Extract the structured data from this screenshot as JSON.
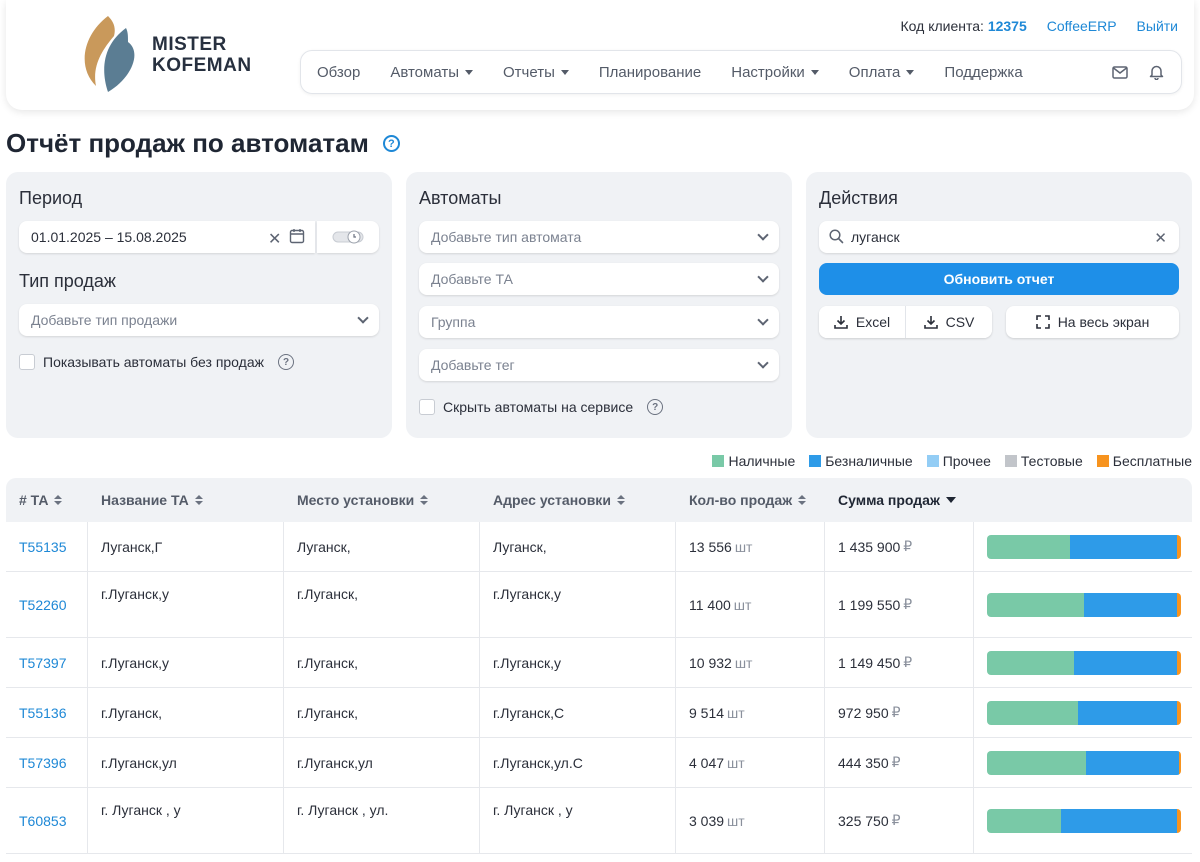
{
  "header": {
    "logo_line1": "MISTER",
    "logo_line2": "KOFEMAN",
    "client_label": "Код клиента:",
    "client_code": "12375",
    "erp_link": "CoffeeERP",
    "logout": "Выйти",
    "nav": [
      {
        "label": "Обзор",
        "dropdown": false
      },
      {
        "label": "Автоматы",
        "dropdown": true
      },
      {
        "label": "Отчеты",
        "dropdown": true
      },
      {
        "label": "Планирование",
        "dropdown": false
      },
      {
        "label": "Настройки",
        "dropdown": true
      },
      {
        "label": "Оплата",
        "dropdown": true
      },
      {
        "label": "Поддержка",
        "dropdown": false
      }
    ],
    "icons": [
      "mail-icon",
      "bell-icon"
    ]
  },
  "page": {
    "title": "Отчёт продаж по автоматам",
    "help": "?"
  },
  "period_panel": {
    "title": "Период",
    "date_range": "01.01.2025 – 15.08.2025",
    "sales_type_title": "Тип продаж",
    "sales_type_placeholder": "Добавьте тип продажи",
    "show_no_sales_label": "Показывать автоматы без продаж"
  },
  "machines_panel": {
    "title": "Автоматы",
    "machine_type_placeholder": "Добавьте тип автомата",
    "ta_placeholder": "Добавьте ТА",
    "group_placeholder": "Группа",
    "tag_placeholder": "Добавьте тег",
    "hide_service_label": "Скрыть автоматы на сервисе"
  },
  "actions_panel": {
    "title": "Действия",
    "search_value": "луганск",
    "refresh_button": "Обновить отчет",
    "excel_button": "Excel",
    "csv_button": "CSV",
    "fullscreen_button": "На весь экран"
  },
  "legend": [
    {
      "label": "Наличные",
      "color": "#79c9a7"
    },
    {
      "label": "Безналичные",
      "color": "#2e9be8"
    },
    {
      "label": "Прочее",
      "color": "#93cdf5"
    },
    {
      "label": "Тестовые",
      "color": "#c2c5ca"
    },
    {
      "label": "Бесплатные",
      "color": "#f7931e"
    }
  ],
  "table": {
    "columns": [
      "# ТА",
      "Название ТА",
      "Место установки",
      "Адрес установки",
      "Кол-во продаж",
      "Сумма продаж"
    ],
    "unit_pcs": "шт",
    "unit_rub": "₽",
    "rows": [
      {
        "id": "T55135",
        "name": "Луганск,Г",
        "place": "Луганск,",
        "address": "Луганск,",
        "count": "13 556",
        "sum": "1 435 900",
        "cash": 0.43,
        "cashless": 0.55,
        "free": 0.02
      },
      {
        "id": "T52260",
        "name": "г.Луганск,у",
        "place": "г.Луганск,",
        "address": "г.Луганск,у",
        "count": "11 400",
        "sum": "1 199 550",
        "cash": 0.5,
        "cashless": 0.48,
        "free": 0.02
      },
      {
        "id": "T57397",
        "name": "г.Луганск,у",
        "place": "г.Луганск,",
        "address": "г.Луганск,у",
        "count": "10 932",
        "sum": "1 149 450",
        "cash": 0.45,
        "cashless": 0.53,
        "free": 0.02
      },
      {
        "id": "T55136",
        "name": "г.Луганск,",
        "place": "г.Луганск,",
        "address": "г.Луганск,С",
        "count": "9 514",
        "sum": "972 950",
        "cash": 0.47,
        "cashless": 0.51,
        "free": 0.02
      },
      {
        "id": "T57396",
        "name": "г.Луганск,ул",
        "place": "г.Луганск,ул",
        "address": "г.Луганск,ул.С",
        "count": "4 047",
        "sum": "444 350",
        "cash": 0.51,
        "cashless": 0.48,
        "free": 0.01
      },
      {
        "id": "T60853",
        "name": "г. Луганск , у",
        "place": "г. Луганск , ул.",
        "address": "г. Луганск , у",
        "count": "3 039",
        "sum": "325 750",
        "cash": 0.38,
        "cashless": 0.6,
        "free": 0.02
      }
    ]
  }
}
